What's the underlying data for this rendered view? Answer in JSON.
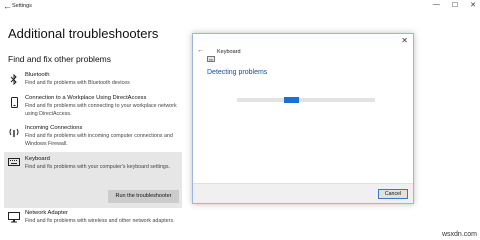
{
  "window": {
    "app_title": "Settings",
    "controls": [
      "—",
      "☐",
      "✕"
    ]
  },
  "page": {
    "title": "Additional troubleshooters",
    "section_title": "Find and fix other problems"
  },
  "troubleshooters": [
    {
      "name": "Bluetooth",
      "desc": "Find and fix problems with Bluetooth devices",
      "icon": "bluetooth-icon"
    },
    {
      "name": "Connection to a Workplace Using DirectAccess",
      "desc": "Find and fix problems with connecting to your workplace network using DirectAccess.",
      "icon": "phone-icon"
    },
    {
      "name": "Incoming Connections",
      "desc": "Find and fix problems with incoming computer connections and Windows Firewall.",
      "icon": "wireless-icon"
    },
    {
      "name": "Keyboard",
      "desc": "Find and fix problems with your computer's keyboard settings.",
      "icon": "keyboard-icon"
    },
    {
      "name": "Network Adapter",
      "desc": "Find and fix problems with wireless and other network adapters.",
      "icon": "monitor-icon"
    }
  ],
  "run_button": "Run the troubleshooter",
  "dialog": {
    "title": "Keyboard",
    "status": "Detecting problems",
    "progress_fraction": 0.35,
    "cancel": "Cancel",
    "close": "✕",
    "back": "←"
  },
  "watermark": "wsxdn.com"
}
